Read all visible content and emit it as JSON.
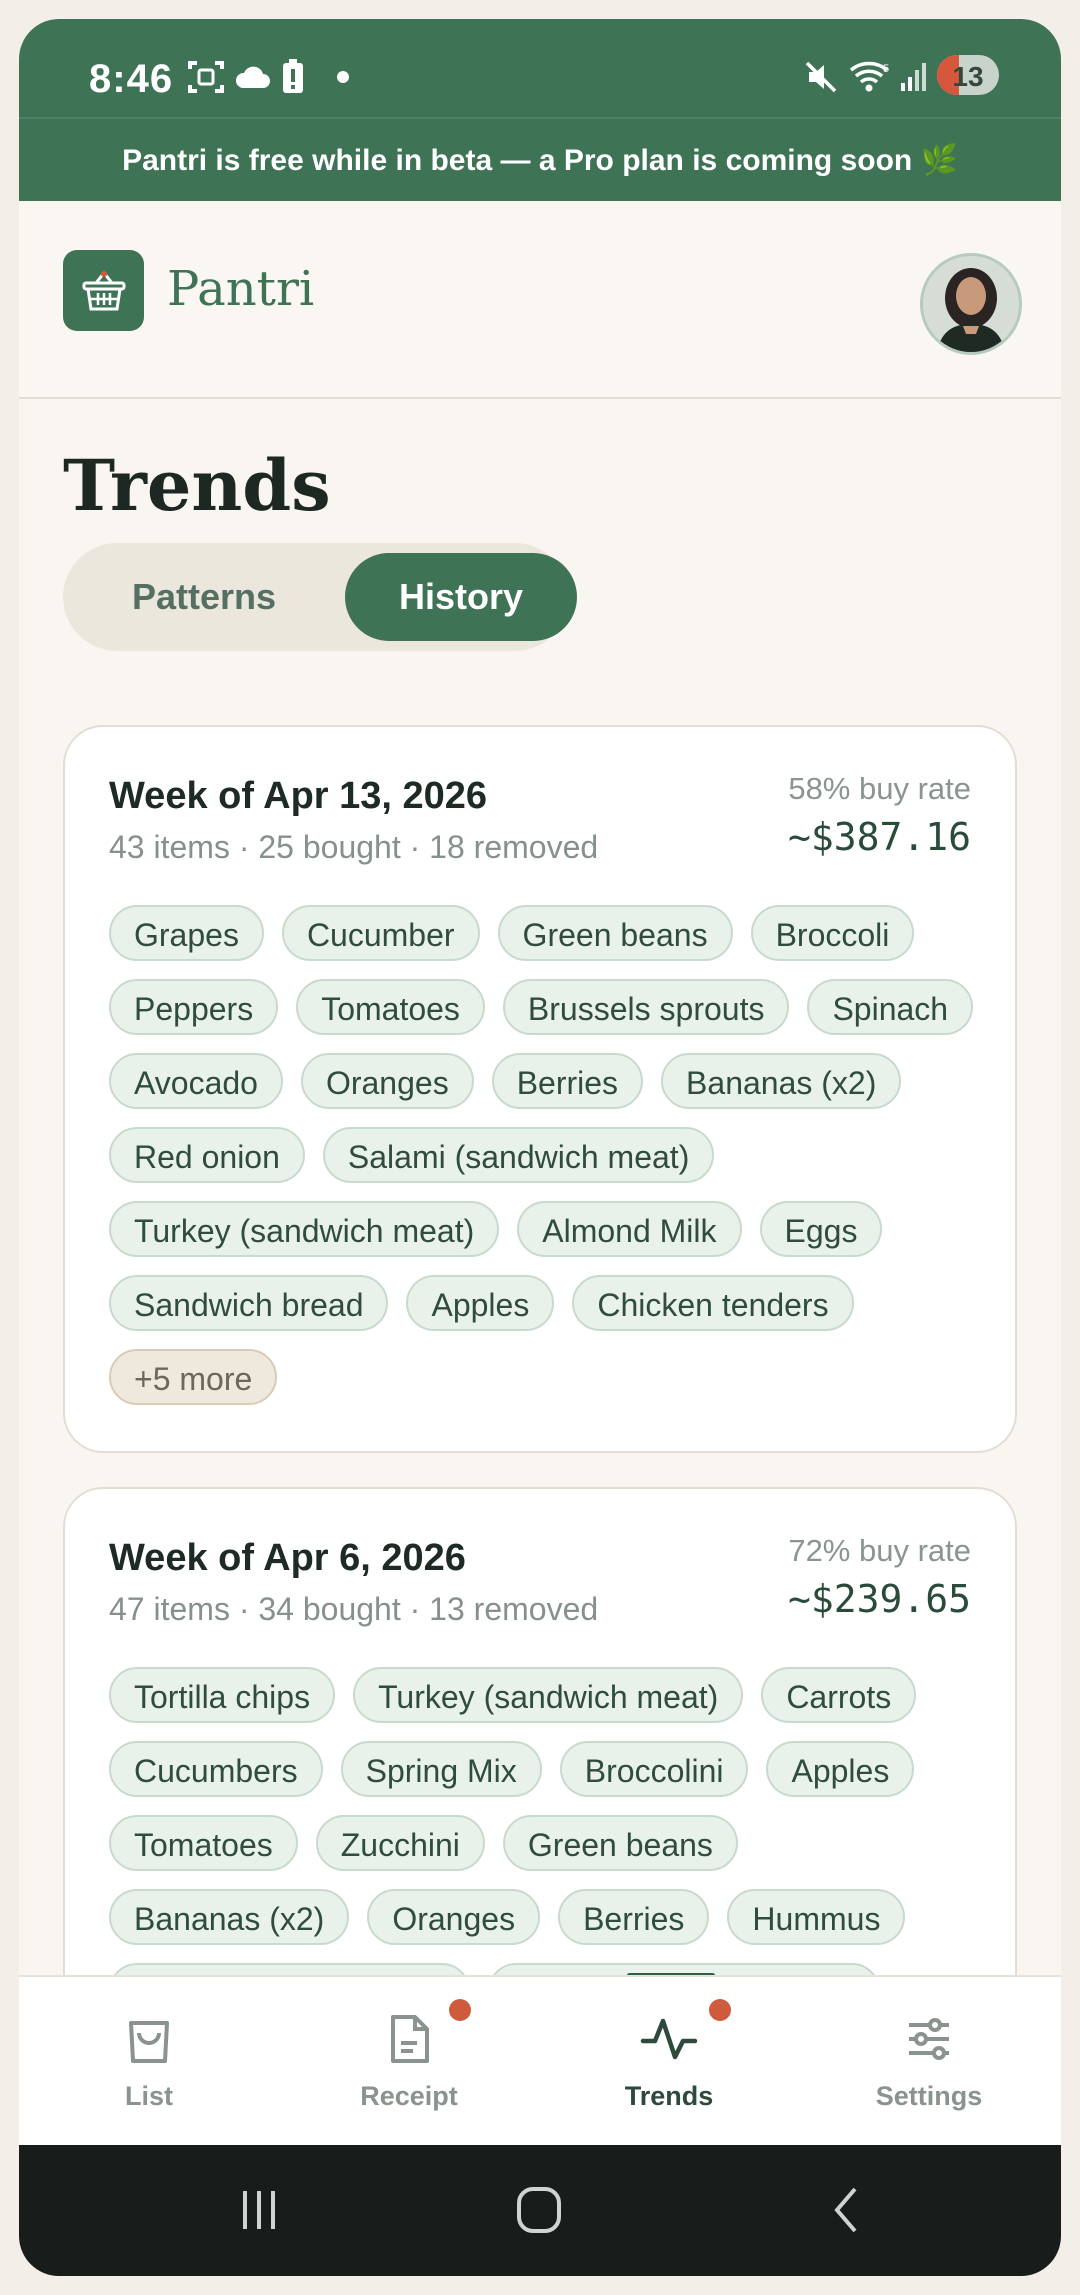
{
  "status": {
    "time": "8:46",
    "notification_count": "13"
  },
  "banner": {
    "text": "Pantri is free while in beta — a Pro plan is coming soon 🌿"
  },
  "app": {
    "name": "Pantri"
  },
  "page": {
    "title": "Trends"
  },
  "segments": {
    "patterns": "Patterns",
    "history": "History",
    "selected": "History"
  },
  "weeks": [
    {
      "title": "Week of Apr 13, 2026",
      "summary": "43 items · 25 bought · 18 removed",
      "buy_rate": "58% buy rate",
      "total": "~$387.16",
      "items": [
        "Grapes",
        "Cucumber",
        "Green beans",
        "Broccoli",
        "Peppers",
        "Tomatoes",
        "Brussels sprouts",
        "Spinach",
        "Avocado",
        "Oranges",
        "Berries",
        "Bananas (x2)",
        "Red onion",
        "Salami (sandwich meat)",
        "Turkey (sandwich meat)",
        "Almond Milk",
        "Eggs",
        "Sandwich bread",
        "Apples",
        "Chicken tenders"
      ],
      "more": "+5 more"
    },
    {
      "title": "Week of Apr 6, 2026",
      "summary": "47 items · 34 bought · 13 removed",
      "buy_rate": "72% buy rate",
      "total": "~$239.65",
      "items": [
        "Tortilla chips",
        "Turkey (sandwich meat)",
        "Carrots",
        "Cucumbers",
        "Spring Mix",
        "Broccolini",
        "Apples",
        "Tomatoes",
        "Zucchini",
        "Green beans",
        "Bananas (x2)",
        "Oranges",
        "Berries",
        "Hummus",
        "Ham (sandwich meat)",
        "Salami (sandwich meat)"
      ]
    }
  ],
  "nav": {
    "items": [
      {
        "label": "List",
        "icon": "bag-icon"
      },
      {
        "label": "Receipt",
        "icon": "receipt-icon"
      },
      {
        "label": "Trends",
        "icon": "pulse-icon"
      },
      {
        "label": "Settings",
        "icon": "sliders-icon"
      }
    ],
    "active": "Trends"
  },
  "colors": {
    "primary": "#3f7356",
    "badge": "#cf5b3f",
    "background": "#f9f6f1"
  }
}
